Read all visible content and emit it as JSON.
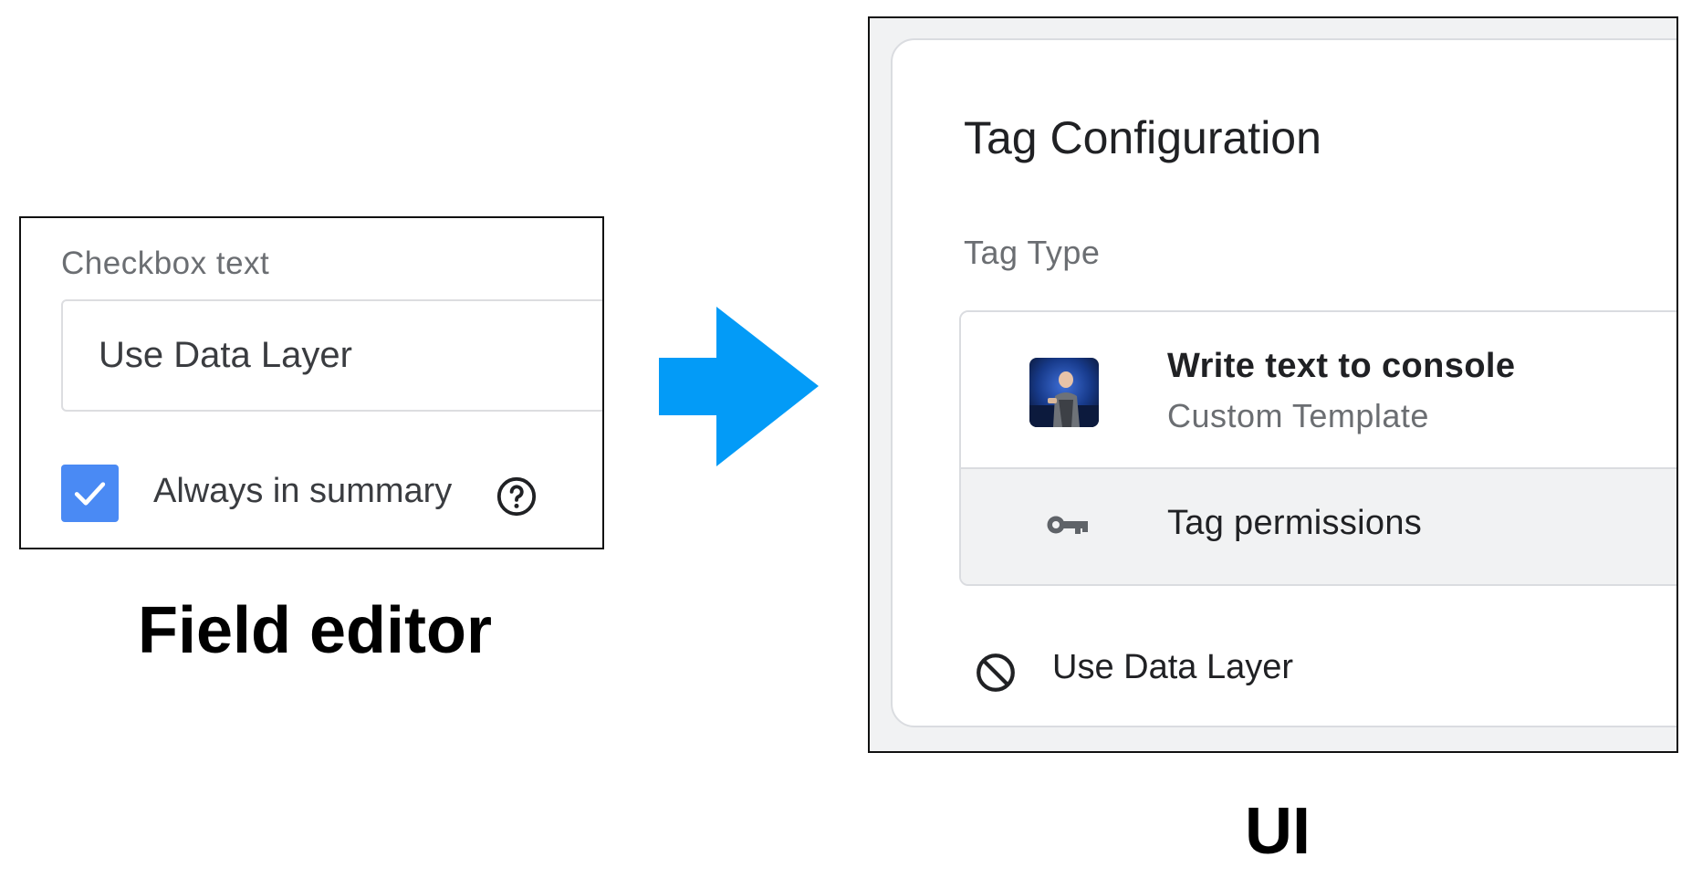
{
  "field_editor": {
    "label": "Checkbox text",
    "input_value": "Use Data Layer",
    "checkbox_checked": true,
    "checkbox_label": "Always in summary",
    "help_icon": "question-circle-icon",
    "checkbox_color": "#4a8af4",
    "caption": "Field editor"
  },
  "arrow": {
    "icon": "right-arrow-icon",
    "color": "#039bf7"
  },
  "ui": {
    "title": "Tag Configuration",
    "section_label": "Tag Type",
    "tag_name": "Write text to console",
    "tag_subtitle": "Custom Template",
    "avatar_icon": "presenter-avatar",
    "permissions_icon": "key-icon",
    "permissions_label": "Tag permissions",
    "data_layer_icon": "block-icon",
    "data_layer_label": "Use Data Layer",
    "caption": "UI"
  }
}
